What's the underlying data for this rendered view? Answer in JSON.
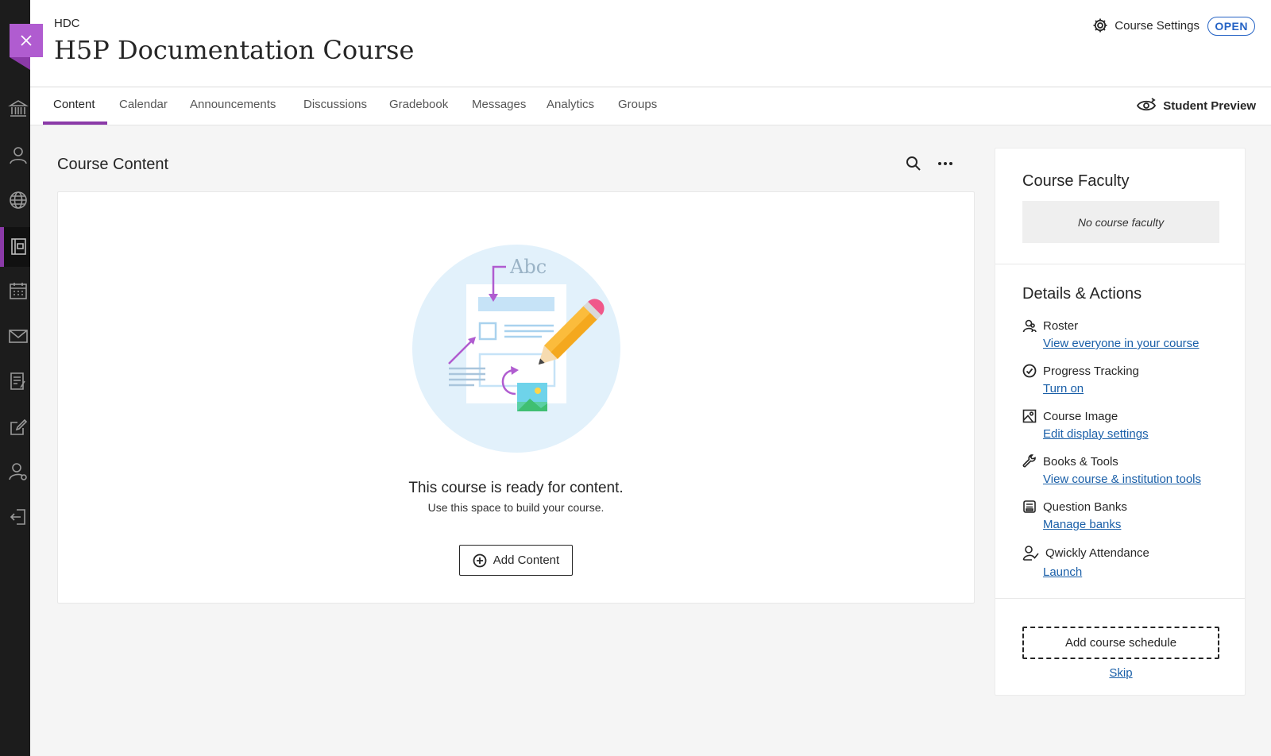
{
  "header": {
    "course_code": "HDC",
    "course_title": "H5P Documentation Course",
    "settings_label": "Course Settings",
    "status_badge": "OPEN"
  },
  "tabs": [
    {
      "label": "Content",
      "active": true
    },
    {
      "label": "Calendar"
    },
    {
      "label": "Announcements"
    },
    {
      "label": "Discussions"
    },
    {
      "label": "Gradebook"
    },
    {
      "label": "Messages"
    },
    {
      "label": "Analytics"
    },
    {
      "label": "Groups"
    }
  ],
  "student_preview_label": "Student Preview",
  "rail_icons": [
    "close-icon",
    "institution-icon",
    "profile-icon",
    "globe-icon",
    "courses-icon",
    "calendar-icon",
    "messages-icon",
    "grades-icon",
    "edit-icon",
    "tools-icon",
    "sign-out-icon"
  ],
  "main": {
    "title": "Course Content",
    "empty_title": "This course is ready for content.",
    "empty_subtitle": "Use this space to build your course.",
    "illustration_text": "Abc",
    "add_button": "Add Content"
  },
  "panel": {
    "faculty_title": "Course Faculty",
    "faculty_empty": "No course faculty",
    "details_title": "Details & Actions",
    "actions": [
      {
        "label": "Roster",
        "link": "View everyone in your course",
        "icon": "roster-icon"
      },
      {
        "label": "Progress Tracking",
        "link": "Turn on",
        "icon": "check-circle-icon"
      },
      {
        "label": "Course Image",
        "link": "Edit display settings",
        "icon": "image-icon"
      },
      {
        "label": "Books & Tools",
        "link": "View course & institution tools",
        "icon": "wrench-icon"
      },
      {
        "label": "Question Banks",
        "link": "Manage banks",
        "icon": "question-bank-icon"
      },
      {
        "label": "Qwickly Attendance",
        "link": "Launch",
        "icon": "attendance-icon"
      }
    ],
    "schedule_button": "Add course schedule",
    "skip_link": "Skip"
  },
  "colors": {
    "accent": "#8b3aa8",
    "close_button": "#b05cd0",
    "link": "#1a5fa8",
    "badge": "#2563c5",
    "rail": "#1c1c1c"
  }
}
